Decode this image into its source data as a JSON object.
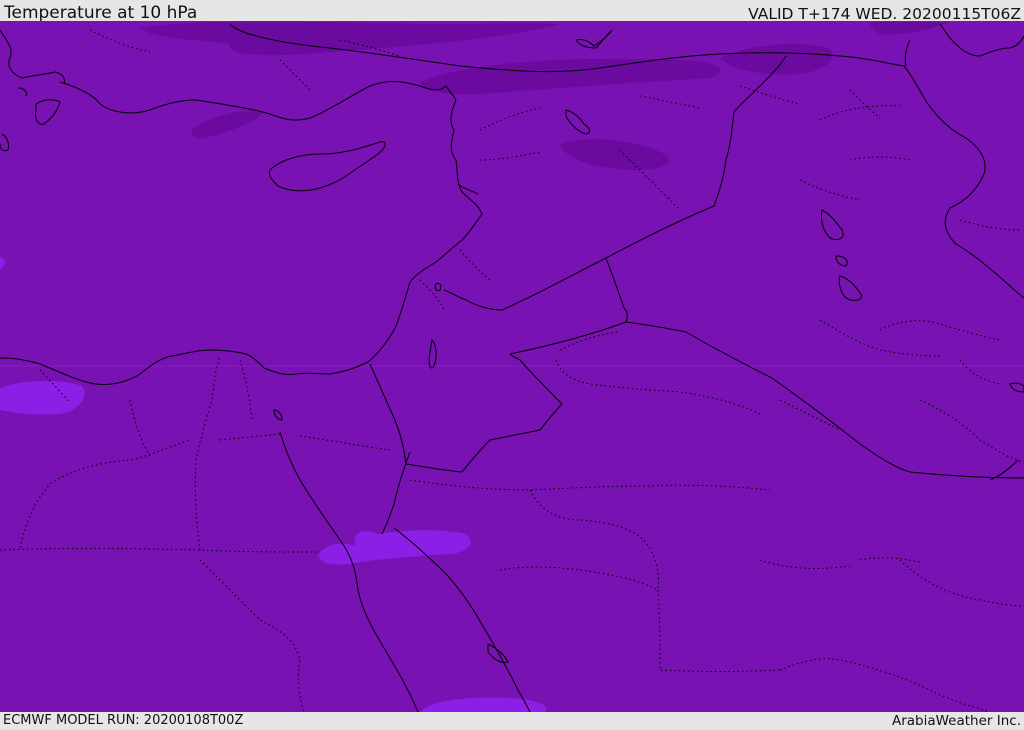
{
  "header": {
    "title": "Temperature at 10 hPa",
    "valid": "VALID T+174 WED. 20200115T06Z"
  },
  "footer": {
    "model_run": "ECMWF MODEL RUN: 20200108T00Z",
    "credit": "ArabiaWeather Inc."
  },
  "map": {
    "colors": {
      "field_base": "#7912b2",
      "field_cold": "#6a0a9e",
      "field_warm": "#8b1fe6",
      "coastline": "#000000",
      "border": "#000000"
    }
  }
}
